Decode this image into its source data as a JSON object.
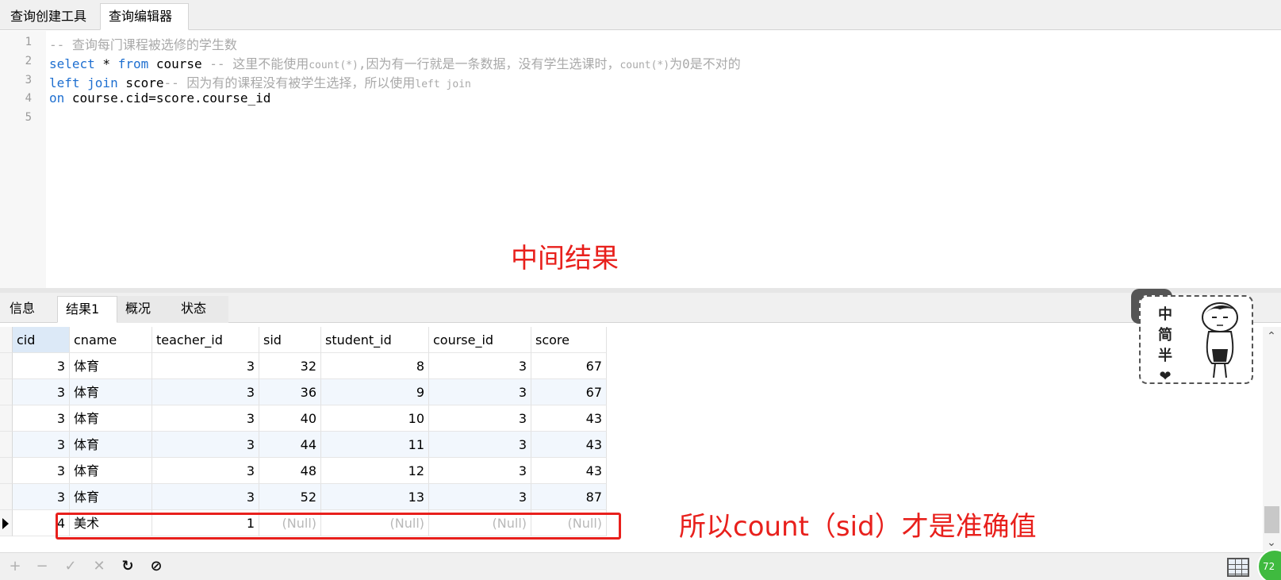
{
  "top_tabs": [
    "查询创建工具",
    "查询编辑器"
  ],
  "editor": {
    "line_numbers": [
      "1",
      "2",
      "3",
      "4",
      "5"
    ],
    "lines": [
      {
        "parts": [
          {
            "t": "-- 查询每门课程被选修的学生数",
            "c": "cm"
          }
        ]
      },
      {
        "parts": [
          {
            "t": "select",
            "c": "kw"
          },
          {
            "t": " * ",
            "c": ""
          },
          {
            "t": "from",
            "c": "kw"
          },
          {
            "t": " course ",
            "c": ""
          },
          {
            "t": "-- 这里不能使用",
            "c": "cm"
          },
          {
            "t": "count(*)",
            "c": "cm-small"
          },
          {
            "t": ",因为有一行就是一条数据，没有学生选课时，",
            "c": "cm"
          },
          {
            "t": "count(*)",
            "c": "cm-small"
          },
          {
            "t": "为0是不对的",
            "c": "cm"
          }
        ]
      },
      {
        "parts": [
          {
            "t": "left join",
            "c": "kw"
          },
          {
            "t": " score",
            "c": ""
          },
          {
            "t": "-- 因为有的课程没有被学生选择，所以使用",
            "c": "cm"
          },
          {
            "t": "left join",
            "c": "cm-small"
          }
        ]
      },
      {
        "parts": [
          {
            "t": "on",
            "c": "kw"
          },
          {
            "t": " course.cid=score.course_id",
            "c": ""
          }
        ]
      },
      {
        "parts": []
      }
    ]
  },
  "annotation_middle": "中间结果",
  "result_tabs": [
    "信息",
    "结果1",
    "概况",
    "状态"
  ],
  "grid": {
    "columns": [
      "cid",
      "cname",
      "teacher_id",
      "sid",
      "student_id",
      "course_id",
      "score"
    ],
    "rows": [
      [
        "3",
        "体育",
        "3",
        "32",
        "8",
        "3",
        "67"
      ],
      [
        "3",
        "体育",
        "3",
        "36",
        "9",
        "3",
        "67"
      ],
      [
        "3",
        "体育",
        "3",
        "40",
        "10",
        "3",
        "43"
      ],
      [
        "3",
        "体育",
        "3",
        "44",
        "11",
        "3",
        "43"
      ],
      [
        "3",
        "体育",
        "3",
        "48",
        "12",
        "3",
        "43"
      ],
      [
        "3",
        "体育",
        "3",
        "52",
        "13",
        "3",
        "87"
      ],
      [
        "4",
        "美术",
        "1",
        "(Null)",
        "(Null)",
        "(Null)",
        "(Null)"
      ]
    ]
  },
  "annotation_bottom": "所以count（sid）才是准确值",
  "sticker_text": [
    "中",
    "简",
    "半",
    "❤"
  ],
  "toolbar": {
    "add": "+",
    "remove": "−",
    "apply": "✓",
    "discard": "✕",
    "refresh": "↻",
    "stop": "⊘"
  },
  "badge_text": "72"
}
